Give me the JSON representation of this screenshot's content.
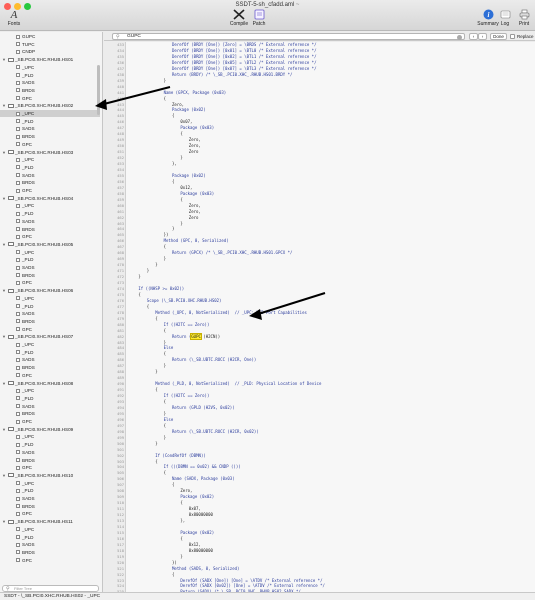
{
  "window": {
    "title": "SSDT-5-sh_cfadd.aml",
    "title_mark": "~",
    "colors": {
      "close": "#fe5f57",
      "minimize": "#febc2e",
      "zoom": "#28c840"
    }
  },
  "toolbar": {
    "fonts_label": "Fonts",
    "compile_label": "Compile",
    "patch_label": "Patch",
    "summary_label": "Summary",
    "log_label": "Log",
    "print_label": "Print"
  },
  "find": {
    "query": "GUPC",
    "done_label": "Done",
    "replace_label": "Replace",
    "prev_icon": "chevron-left-icon",
    "next_icon": "chevron-right-icon"
  },
  "sidebar": {
    "search_placeholder": "Filter Tree",
    "items": [
      {
        "label": "GUPC",
        "type": "item",
        "indent": 1
      },
      {
        "label": "TUPC",
        "type": "item",
        "indent": 1
      },
      {
        "label": "CNDP",
        "type": "item",
        "indent": 1
      },
      {
        "label": "_SB.PCI0.XHC.RHUB.HS01",
        "type": "folder",
        "indent": 0
      },
      {
        "label": "_UPC",
        "type": "item",
        "indent": 1
      },
      {
        "label": "_PLD",
        "type": "item",
        "indent": 1
      },
      {
        "label": "SADS",
        "type": "item",
        "indent": 1
      },
      {
        "label": "BRDS",
        "type": "item",
        "indent": 1
      },
      {
        "label": "GPC",
        "type": "item",
        "indent": 1
      },
      {
        "label": "_SB.PCI0.XHC.RHUB.HS02",
        "type": "folder",
        "indent": 0
      },
      {
        "label": "_UPC",
        "type": "item",
        "indent": 1,
        "selected": true
      },
      {
        "label": "_PLD",
        "type": "item",
        "indent": 1
      },
      {
        "label": "SADS",
        "type": "item",
        "indent": 1
      },
      {
        "label": "BRDS",
        "type": "item",
        "indent": 1
      },
      {
        "label": "GPC",
        "type": "item",
        "indent": 1
      },
      {
        "label": "_SB.PCI0.XHC.RHUB.HS03",
        "type": "folder",
        "indent": 0
      },
      {
        "label": "_UPC",
        "type": "item",
        "indent": 1
      },
      {
        "label": "_PLD",
        "type": "item",
        "indent": 1
      },
      {
        "label": "SADS",
        "type": "item",
        "indent": 1
      },
      {
        "label": "BRDS",
        "type": "item",
        "indent": 1
      },
      {
        "label": "GPC",
        "type": "item",
        "indent": 1
      },
      {
        "label": "_SB.PCI0.XHC.RHUB.HS04",
        "type": "folder",
        "indent": 0
      },
      {
        "label": "_UPC",
        "type": "item",
        "indent": 1
      },
      {
        "label": "_PLD",
        "type": "item",
        "indent": 1
      },
      {
        "label": "SADS",
        "type": "item",
        "indent": 1
      },
      {
        "label": "BRDS",
        "type": "item",
        "indent": 1
      },
      {
        "label": "GPC",
        "type": "item",
        "indent": 1
      },
      {
        "label": "_SB.PCI0.XHC.RHUB.HS05",
        "type": "folder",
        "indent": 0
      },
      {
        "label": "_UPC",
        "type": "item",
        "indent": 1
      },
      {
        "label": "_PLD",
        "type": "item",
        "indent": 1
      },
      {
        "label": "SADS",
        "type": "item",
        "indent": 1
      },
      {
        "label": "BRDS",
        "type": "item",
        "indent": 1
      },
      {
        "label": "GPC",
        "type": "item",
        "indent": 1
      },
      {
        "label": "_SB.PCI0.XHC.RHUB.HS06",
        "type": "folder",
        "indent": 0
      },
      {
        "label": "_UPC",
        "type": "item",
        "indent": 1
      },
      {
        "label": "_PLD",
        "type": "item",
        "indent": 1
      },
      {
        "label": "SADS",
        "type": "item",
        "indent": 1
      },
      {
        "label": "BRDS",
        "type": "item",
        "indent": 1
      },
      {
        "label": "GPC",
        "type": "item",
        "indent": 1
      },
      {
        "label": "_SB.PCI0.XHC.RHUB.HS07",
        "type": "folder",
        "indent": 0
      },
      {
        "label": "_UPC",
        "type": "item",
        "indent": 1
      },
      {
        "label": "_PLD",
        "type": "item",
        "indent": 1
      },
      {
        "label": "SADS",
        "type": "item",
        "indent": 1
      },
      {
        "label": "BRDS",
        "type": "item",
        "indent": 1
      },
      {
        "label": "GPC",
        "type": "item",
        "indent": 1
      },
      {
        "label": "_SB.PCI0.XHC.RHUB.HS08",
        "type": "folder",
        "indent": 0
      },
      {
        "label": "_UPC",
        "type": "item",
        "indent": 1
      },
      {
        "label": "_PLD",
        "type": "item",
        "indent": 1
      },
      {
        "label": "SADS",
        "type": "item",
        "indent": 1
      },
      {
        "label": "BRDS",
        "type": "item",
        "indent": 1
      },
      {
        "label": "GPC",
        "type": "item",
        "indent": 1
      },
      {
        "label": "_SB.PCI0.XHC.RHUB.HS09",
        "type": "folder",
        "indent": 0
      },
      {
        "label": "_UPC",
        "type": "item",
        "indent": 1
      },
      {
        "label": "_PLD",
        "type": "item",
        "indent": 1
      },
      {
        "label": "SADS",
        "type": "item",
        "indent": 1
      },
      {
        "label": "BRDS",
        "type": "item",
        "indent": 1
      },
      {
        "label": "GPC",
        "type": "item",
        "indent": 1
      },
      {
        "label": "_SB.PCI0.XHC.RHUB.HS10",
        "type": "folder",
        "indent": 0
      },
      {
        "label": "_UPC",
        "type": "item",
        "indent": 1
      },
      {
        "label": "_PLD",
        "type": "item",
        "indent": 1
      },
      {
        "label": "SADS",
        "type": "item",
        "indent": 1
      },
      {
        "label": "BRDS",
        "type": "item",
        "indent": 1
      },
      {
        "label": "GPC",
        "type": "item",
        "indent": 1
      },
      {
        "label": "_SB.PCI0.XHC.RHUB.HS11",
        "type": "folder",
        "indent": 0
      },
      {
        "label": "_UPC",
        "type": "item",
        "indent": 1
      },
      {
        "label": "_PLD",
        "type": "item",
        "indent": 1
      },
      {
        "label": "SADS",
        "type": "item",
        "indent": 1
      },
      {
        "label": "BRDS",
        "type": "item",
        "indent": 1
      },
      {
        "label": "GPC",
        "type": "item",
        "indent": 1
      }
    ]
  },
  "status_bar": {
    "path": "SSDT - \\_SB.PCI0.XHC.RHUB.HS02 - _UPC"
  },
  "editor": {
    "first_line_number": 433,
    "highlight_color": "#ffec2e",
    "lines": [
      {
        "i": 5,
        "t": "DerefOf (BRDY [One]) [Zero] = \\BRDS /* External reference */"
      },
      {
        "i": 5,
        "t": "DerefOf (BRDY [One]) [0x01] = \\BTL0 /* External reference */"
      },
      {
        "i": 5,
        "t": "DerefOf (BRDY [One]) [0x02] = \\BTL1 /* External reference */"
      },
      {
        "i": 5,
        "t": "DerefOf (BRDY [One]) [0x05] = \\BTL2 /* External reference */"
      },
      {
        "i": 5,
        "t": "DerefOf (BRDY [One]) [0x07] = \\BTL3 /* External reference */"
      },
      {
        "i": 5,
        "t": "Return (BRDY) /* \\_SB_.PCI0.XHC_.RHUB.HS01.BRDY */"
      },
      {
        "i": 4,
        "t": "}"
      },
      {
        "i": 0,
        "t": ""
      },
      {
        "i": 4,
        "t": "Name (GPCX, Package (0x03)"
      },
      {
        "i": 4,
        "t": "{"
      },
      {
        "i": 5,
        "t": "Zero,"
      },
      {
        "i": 5,
        "t": "Package (0x02)"
      },
      {
        "i": 5,
        "t": "{"
      },
      {
        "i": 6,
        "t": "0x07,"
      },
      {
        "i": 6,
        "t": "Package (0x03)"
      },
      {
        "i": 6,
        "t": "{"
      },
      {
        "i": 7,
        "t": "Zero,"
      },
      {
        "i": 7,
        "t": "Zero,"
      },
      {
        "i": 7,
        "t": "Zero"
      },
      {
        "i": 6,
        "t": "}"
      },
      {
        "i": 5,
        "t": "},"
      },
      {
        "i": 0,
        "t": ""
      },
      {
        "i": 5,
        "t": "Package (0x02)"
      },
      {
        "i": 5,
        "t": "{"
      },
      {
        "i": 6,
        "t": "0x12,"
      },
      {
        "i": 6,
        "t": "Package (0x03)"
      },
      {
        "i": 6,
        "t": "{"
      },
      {
        "i": 7,
        "t": "Zero,"
      },
      {
        "i": 7,
        "t": "Zero,"
      },
      {
        "i": 7,
        "t": "Zero"
      },
      {
        "i": 6,
        "t": "}"
      },
      {
        "i": 5,
        "t": "}"
      },
      {
        "i": 4,
        "t": "})"
      },
      {
        "i": 4,
        "t": "Method (GPC, 0, Serialized)"
      },
      {
        "i": 4,
        "t": "{"
      },
      {
        "i": 5,
        "t": "Return (GPCX) /* \\_SB_.PCI0.XHC_.RHUB.HS01.GPCX */"
      },
      {
        "i": 4,
        "t": "}"
      },
      {
        "i": 3,
        "t": "}"
      },
      {
        "i": 2,
        "t": "}"
      },
      {
        "i": 1,
        "t": "}"
      },
      {
        "i": 0,
        "t": ""
      },
      {
        "i": 1,
        "t": "If ((NHSP >= 0x02))"
      },
      {
        "i": 1,
        "t": "{"
      },
      {
        "i": 2,
        "t": "Scope (\\_SB.PCI0.XHC.RHUB.HS02)"
      },
      {
        "i": 2,
        "t": "{"
      },
      {
        "i": 3,
        "t": "Method (_UPC, 0, NotSerialized)  // _UPC: USB Port Capabilities"
      },
      {
        "i": 3,
        "t": "{"
      },
      {
        "i": 4,
        "t": "If ((H2TC == Zero))"
      },
      {
        "i": 4,
        "t": "{"
      },
      {
        "i": 5,
        "t": "Return (",
        "h": "GUPC",
        "a": " (H2CN))"
      },
      {
        "i": 4,
        "t": "}"
      },
      {
        "i": 4,
        "t": "Else"
      },
      {
        "i": 4,
        "t": "{"
      },
      {
        "i": 5,
        "t": "Return (\\_SB.UBTC.RUCC (H2CR, One))"
      },
      {
        "i": 4,
        "t": "}"
      },
      {
        "i": 3,
        "t": "}"
      },
      {
        "i": 0,
        "t": ""
      },
      {
        "i": 3,
        "t": "Method (_PLD, 0, NotSerialized)  // _PLD: Physical Location of Device"
      },
      {
        "i": 3,
        "t": "{"
      },
      {
        "i": 4,
        "t": "If ((H2TC == Zero))"
      },
      {
        "i": 4,
        "t": "{"
      },
      {
        "i": 5,
        "t": "Return (GPLD (H2VS, 0x02))"
      },
      {
        "i": 4,
        "t": "}"
      },
      {
        "i": 4,
        "t": "Else"
      },
      {
        "i": 4,
        "t": "{"
      },
      {
        "i": 5,
        "t": "Return (\\_SB.UBTC.RUCC (H2CR, 0x02))"
      },
      {
        "i": 4,
        "t": "}"
      },
      {
        "i": 3,
        "t": "}"
      },
      {
        "i": 0,
        "t": ""
      },
      {
        "i": 3,
        "t": "If (CondRefOf (DBMN))"
      },
      {
        "i": 3,
        "t": "{"
      },
      {
        "i": 4,
        "t": "If (((DBMN == 0x02) && CNDP ()))"
      },
      {
        "i": 4,
        "t": "{"
      },
      {
        "i": 5,
        "t": "Name (SADX, Package (0x03)"
      },
      {
        "i": 5,
        "t": "{"
      },
      {
        "i": 6,
        "t": "Zero,"
      },
      {
        "i": 6,
        "t": "Package (0x02)"
      },
      {
        "i": 6,
        "t": "{"
      },
      {
        "i": 7,
        "t": "0x07,"
      },
      {
        "i": 7,
        "t": "0x80000000"
      },
      {
        "i": 6,
        "t": "},"
      },
      {
        "i": 0,
        "t": ""
      },
      {
        "i": 6,
        "t": "Package (0x02)"
      },
      {
        "i": 6,
        "t": "{"
      },
      {
        "i": 7,
        "t": "0x12,"
      },
      {
        "i": 7,
        "t": "0x80000000"
      },
      {
        "i": 6,
        "t": "}"
      },
      {
        "i": 5,
        "t": "})"
      },
      {
        "i": 5,
        "t": "Method (SADS, 0, Serialized)"
      },
      {
        "i": 5,
        "t": "{"
      },
      {
        "i": 6,
        "t": "DerefOf (SADX [One]) [One] = \\ATDV /* External reference */"
      },
      {
        "i": 6,
        "t": "DerefOf (SADX [0x02]) [One] = \\ATDV /* External reference */"
      },
      {
        "i": 6,
        "t": "Return (SADX) /* \\_SB_.PCI0.XHC_.RHUB.HS02.SADX */"
      },
      {
        "i": 5,
        "t": "}"
      },
      {
        "i": 0,
        "t": ""
      },
      {
        "i": 5,
        "t": "Name (BRDY, Package (0x02)"
      },
      {
        "i": 5,
        "t": "{"
      },
      {
        "i": 6,
        "t": "Zero,"
      },
      {
        "i": 6,
        "t": "Package (0x08)"
      }
    ]
  }
}
